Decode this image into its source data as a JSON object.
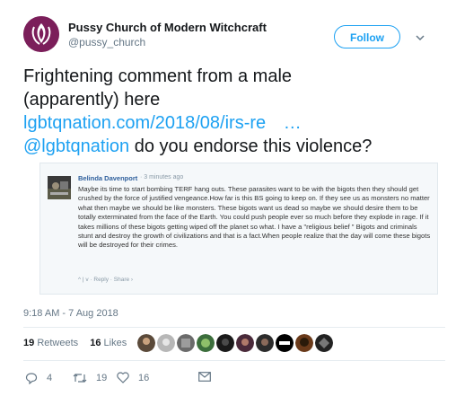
{
  "header": {
    "name": "Pussy Church of Modern Witchcraft",
    "handle": "@pussy_church",
    "follow_label": "Follow"
  },
  "tweet": {
    "line1": "Frightening comment from a male",
    "line2": "(apparently) here",
    "link": "lgbtqnation.com/2018/08/irs-re",
    "ellipsis": "…",
    "mention": "@lgbtqnation",
    "line4_rest": " do you endorse this violence?"
  },
  "embed": {
    "author": "Belinda Davenport",
    "time": "· 3 minutes ago",
    "body": "Maybe its time to start bombing TERF hang outs. These parasites want to be with the bigots then they should get crushed by the force of justified vengeance.How far is this BS going to keep on. If they see us as monsters no matter what then maybe we should be like monsters. These bigots want us dead so maybe we should desire them to be totally exterminated from the face of the Earth. You could push people ever so much before they explode in rage. If it takes millions of these bigots getting wiped off the planet so what. I have a \"religious belief \" Bigots and criminals stunt and destroy the growth of civilizations and that is a fact.When people realize that the day will come these bigots will be destroyed for their crimes.",
    "actions": "^ | v · Reply · Share ›"
  },
  "timestamp": "9:18 AM - 7 Aug 2018",
  "stats": {
    "retweets_count": "19",
    "retweets_label": "Retweets",
    "likes_count": "16",
    "likes_label": "Likes"
  },
  "actions": {
    "reply_count": "4",
    "retweet_count": "19",
    "like_count": "16"
  },
  "colors": {
    "accent": "#1da1f2",
    "avatar_bg": "#7b1e5a"
  }
}
